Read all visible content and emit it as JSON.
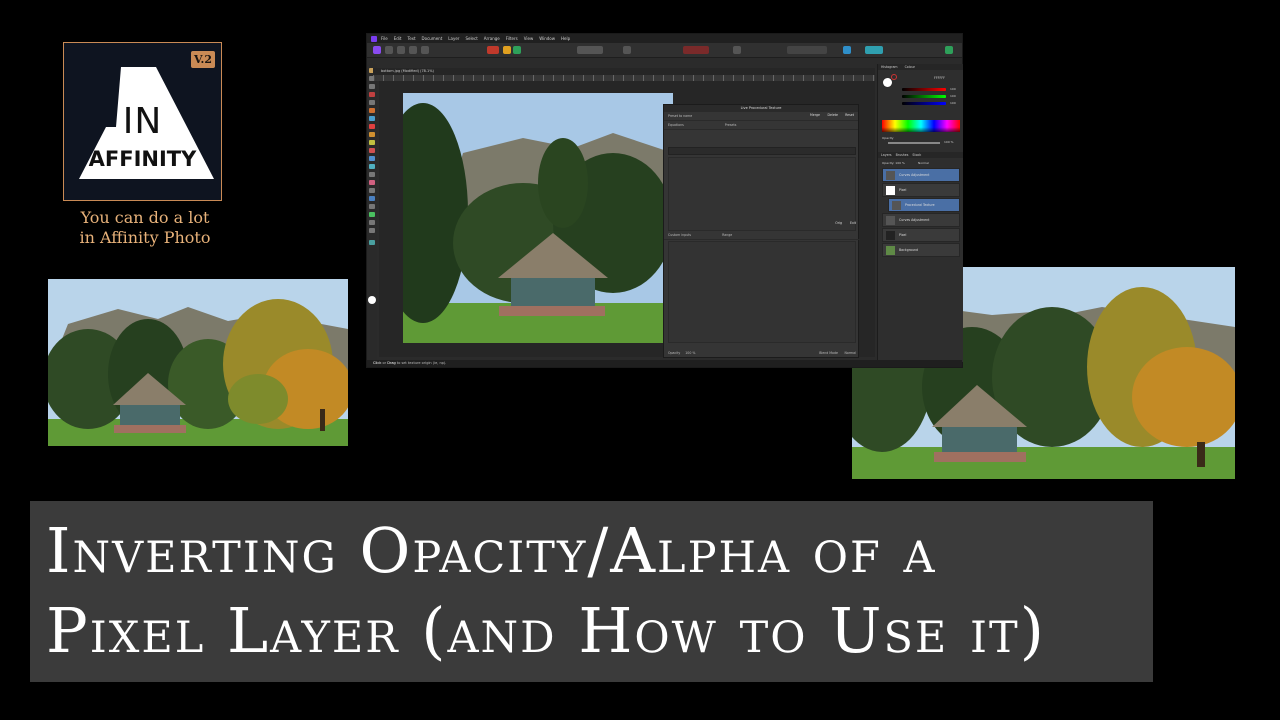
{
  "logo": {
    "badge": "V.2",
    "line1": "IN",
    "line2": "AFFINITY"
  },
  "tagline": {
    "line1": "You can do a lot",
    "line2": "in Affinity Photo"
  },
  "app": {
    "menu": [
      "File",
      "Edit",
      "Text",
      "Document",
      "Layer",
      "Select",
      "Arrange",
      "Filters",
      "View",
      "Window",
      "Help"
    ],
    "document_tab": "bottom.jpg (Modified) (78.1%)",
    "dialog": {
      "title": "Live Procedural Texture",
      "preset_label": "Preset to name",
      "buttons": [
        "Merge",
        "Delete",
        "Reset"
      ],
      "equations_label": "Equations",
      "presets_label": "Presets",
      "custom_inputs_label": "Custom inputs",
      "range_label": "Range",
      "opacity_label": "Opacity",
      "opacity_value": "100 %",
      "blend_mode_label": "Blend Mode",
      "blend_mode_value": "Normal",
      "bottom_buttons": [
        "Orig",
        "Exit"
      ]
    },
    "panel": {
      "tabs": [
        "Histogram",
        "Colour"
      ],
      "opacity_label": "Opacity",
      "opacity_value": "100 %",
      "hex_value": "FFFFFF",
      "channel_values": [
        "100",
        "100",
        "100"
      ],
      "layers_tabs": [
        "Layers",
        "Brushes",
        "Stock"
      ],
      "layers_opacity": "Opacity: 100 %",
      "layers_blend": "Normal",
      "layers": [
        {
          "name": "Curves Adjustment",
          "selected": true
        },
        {
          "name": "Pixel",
          "selected": false
        },
        {
          "name": "Procedural Texture",
          "selected": true
        },
        {
          "name": "Curves Adjustment",
          "selected": false
        },
        {
          "name": "Pixel",
          "selected": false
        },
        {
          "name": "Background",
          "selected": false
        }
      ]
    },
    "status": {
      "bold": "Click",
      "middle": "or",
      "bold2": "Drag",
      "rest": "to set texture origin (ie, np)."
    }
  },
  "title": {
    "line1": "Inverting Opacity/Alpha of a",
    "line2": "Pixel Layer (and How to Use it)"
  },
  "colors": {
    "accent_orange": "#c98a55",
    "tagline": "#e8b27a",
    "banner_bg": "#3b3b3b",
    "layer_selected": "#4a6fa5"
  }
}
